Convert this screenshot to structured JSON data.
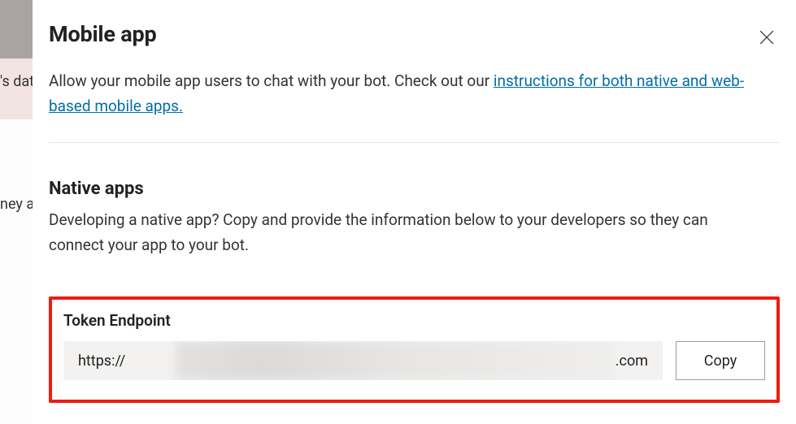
{
  "background": {
    "fragment1": "'s dat",
    "fragment2": "ney a"
  },
  "panel": {
    "title": "Mobile app",
    "description_prefix": "Allow your mobile app users to chat with your bot. Check out our ",
    "description_link": "instructions for both native and web-based mobile apps.",
    "native": {
      "title": "Native apps",
      "description": "Developing a native app? Copy and provide the information below to your developers so they can connect your app to your bot."
    },
    "token": {
      "label": "Token Endpoint",
      "value_prefix": "https://",
      "value_suffix": ".com",
      "copy_label": "Copy"
    }
  }
}
